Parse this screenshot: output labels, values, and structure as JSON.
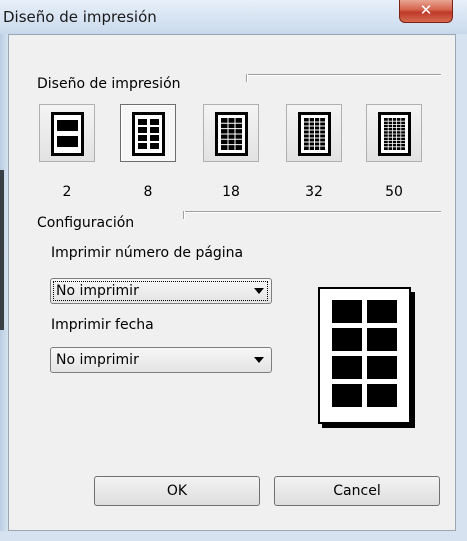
{
  "window": {
    "title": "Diseño de impresión",
    "close_glyph": "✕"
  },
  "layout_group": {
    "label": "Diseño de impresión",
    "options": [
      {
        "count": "2",
        "icon": "layout-2-icon",
        "selected": false
      },
      {
        "count": "8",
        "icon": "layout-8-icon",
        "selected": true
      },
      {
        "count": "18",
        "icon": "layout-18-icon",
        "selected": false
      },
      {
        "count": "32",
        "icon": "layout-32-icon",
        "selected": false
      },
      {
        "count": "50",
        "icon": "layout-50-icon",
        "selected": false
      }
    ]
  },
  "config_group": {
    "label": "Configuración",
    "page_number": {
      "label": "Imprimir número de página",
      "value": "No imprimir"
    },
    "date": {
      "label": "Imprimir fecha",
      "value": "No imprimir"
    }
  },
  "buttons": {
    "ok": "OK",
    "cancel": "Cancel"
  }
}
